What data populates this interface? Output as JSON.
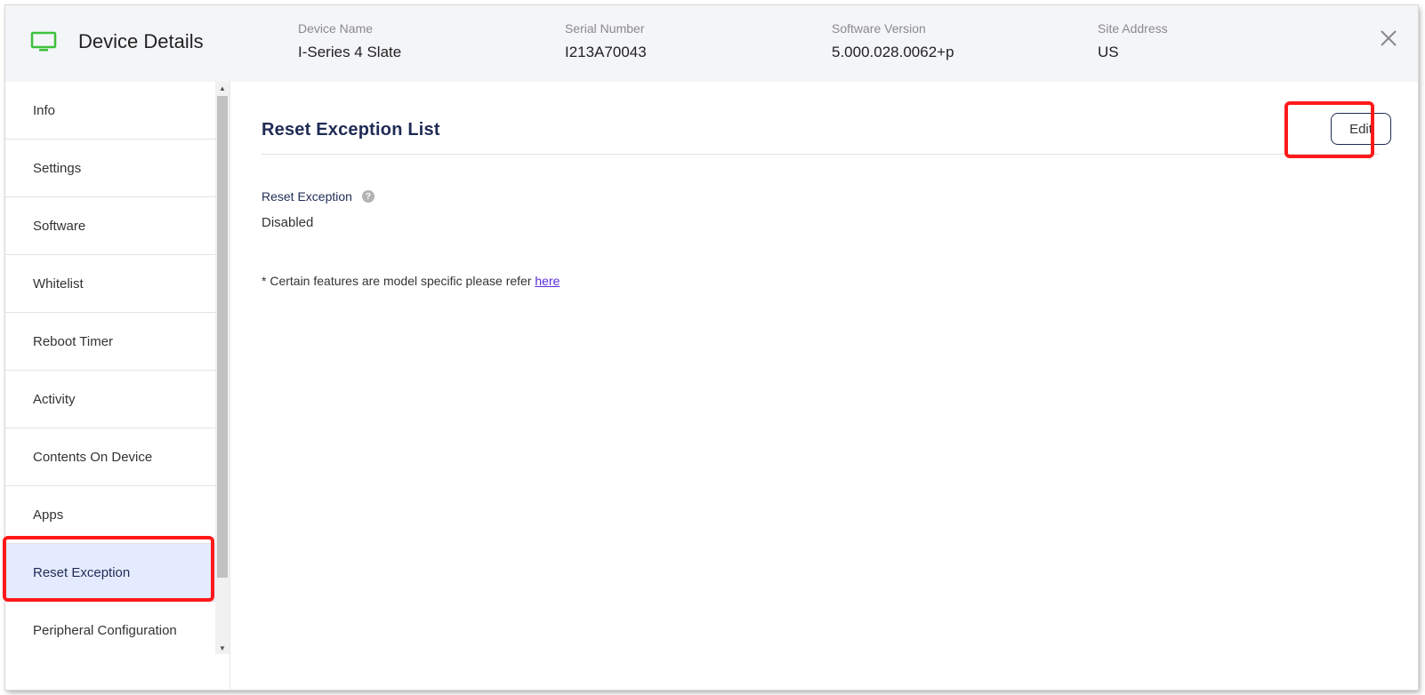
{
  "header": {
    "title": "Device Details",
    "icon": "monitor-icon",
    "accent_color": "#3cc23c",
    "fields": [
      {
        "label": "Device Name",
        "value": "I-Series 4 Slate"
      },
      {
        "label": "Serial Number",
        "value": "I213A70043"
      },
      {
        "label": "Software Version",
        "value": "5.000.028.0062+p"
      },
      {
        "label": "Site Address",
        "value": "US"
      }
    ]
  },
  "sidebar": {
    "items": [
      {
        "label": "Info"
      },
      {
        "label": "Settings"
      },
      {
        "label": "Software"
      },
      {
        "label": "Whitelist"
      },
      {
        "label": "Reboot Timer"
      },
      {
        "label": "Activity"
      },
      {
        "label": "Contents On Device"
      },
      {
        "label": "Apps"
      },
      {
        "label": "Reset Exception",
        "active": true
      },
      {
        "label": "Peripheral Configuration"
      }
    ]
  },
  "main": {
    "section_title": "Reset Exception List",
    "edit_label": "Edit",
    "field": {
      "label": "Reset Exception",
      "value": "Disabled"
    },
    "note_text": "* Certain features are model specific please refer ",
    "note_link": "here"
  },
  "colors": {
    "highlight": "#ff1a1a",
    "active_item_bg": "#e4ebff",
    "title_color": "#1f2b55",
    "link_color": "#5a2bd6"
  }
}
